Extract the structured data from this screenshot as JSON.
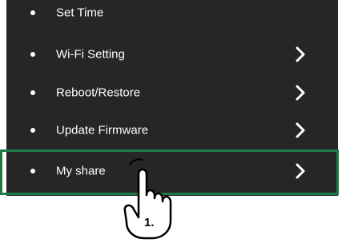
{
  "menu": {
    "items": [
      {
        "label": "Set Time",
        "has_arrow": false
      },
      {
        "label": "Wi-Fi Setting",
        "has_arrow": true
      },
      {
        "label": "Reboot/Restore",
        "has_arrow": true
      },
      {
        "label": "Update Firmware",
        "has_arrow": true
      },
      {
        "label": "My share",
        "has_arrow": true
      }
    ]
  },
  "annotation": {
    "step_label": "1.",
    "highlight_color": "#1d7a45",
    "icon": "tap-hand-icon"
  },
  "colors": {
    "panel_bg": "#262626",
    "text": "#ffffff"
  }
}
